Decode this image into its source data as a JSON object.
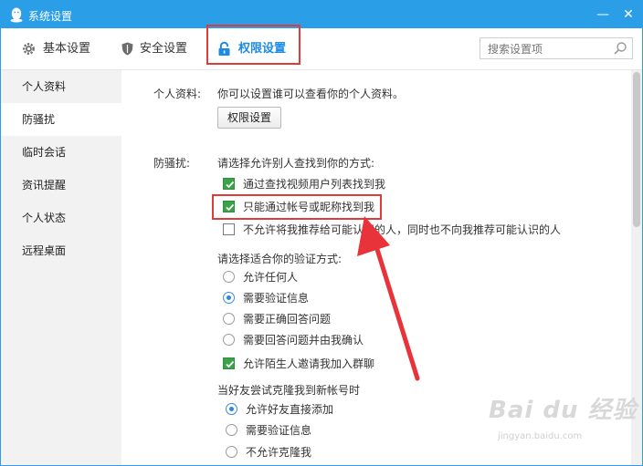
{
  "window": {
    "title": "系统设置",
    "minimize_label": "—",
    "close_label": "✕"
  },
  "tabs": [
    {
      "label": "基本设置",
      "icon": "gear-icon"
    },
    {
      "label": "安全设置",
      "icon": "shield-icon"
    },
    {
      "label": "权限设置",
      "icon": "lock-icon",
      "active": true
    }
  ],
  "search": {
    "placeholder": "搜索设置项",
    "value": ""
  },
  "sidebar": {
    "items": [
      {
        "label": "个人资料"
      },
      {
        "label": "防骚扰",
        "active": true
      },
      {
        "label": "临时会话"
      },
      {
        "label": "资讯提醒"
      },
      {
        "label": "个人状态"
      },
      {
        "label": "远程桌面"
      }
    ]
  },
  "profile": {
    "label": "个人资料:",
    "desc": "你可以设置谁可以查看你的个人资料。",
    "button": "权限设置"
  },
  "harass": {
    "label": "防骚扰:",
    "find_prompt": "请选择允许别人查找到你的方式:",
    "find_options": [
      {
        "text": "通过查找视频用户列表找到我",
        "checked": true
      },
      {
        "text": "只能通过帐号或昵称找到我",
        "checked": true
      },
      {
        "text": "不允许将我推荐给可能认识的人，同时也不向我推荐可能认识的人",
        "checked": false
      }
    ],
    "verify_prompt": "请选择适合你的验证方式:",
    "verify_options": [
      {
        "text": "允许任何人",
        "selected": false
      },
      {
        "text": "需要验证信息",
        "selected": true
      },
      {
        "text": "需要正确回答问题",
        "selected": false
      },
      {
        "text": "需要回答问题并由我确认",
        "selected": false
      }
    ],
    "stranger_group": {
      "text": "允许陌生人邀请我加入群聊",
      "checked": true
    },
    "clone_prompt": "当好友尝试克隆我到新帐号时",
    "clone_options": [
      {
        "text": "允许好友直接添加",
        "selected": true
      },
      {
        "text": "需要验证信息",
        "selected": false
      },
      {
        "text": "不允许克隆我",
        "selected": false
      }
    ]
  },
  "watermark": {
    "brand": "Bai du 经验",
    "url": "jingyan.baidu.com"
  },
  "colors": {
    "titlebar": "#2b9ee8",
    "accent": "#1e8be3",
    "highlight_box": "#e03b3b",
    "checkbox": "#3aa34a",
    "arrow": "#e8333a"
  }
}
